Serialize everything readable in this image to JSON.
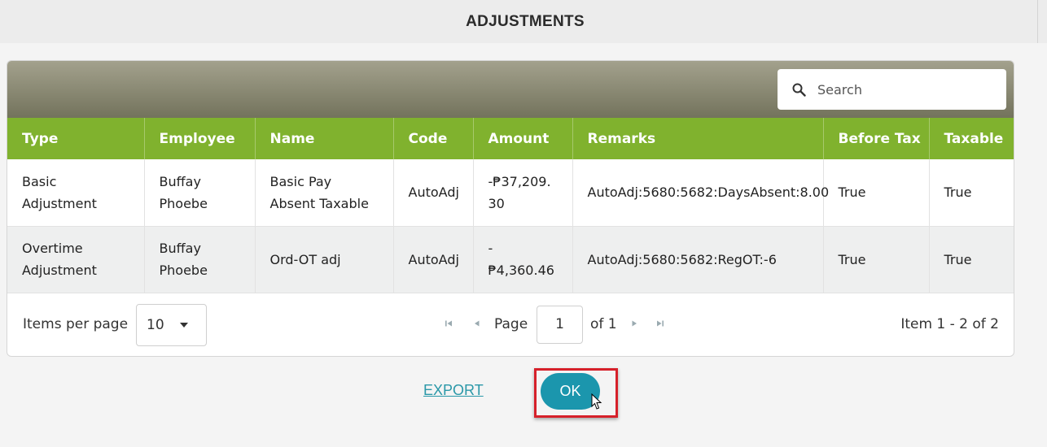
{
  "header": {
    "title": "ADJUSTMENTS"
  },
  "search": {
    "placeholder": "Search"
  },
  "columns": [
    "Type",
    "Employee",
    "Name",
    "Code",
    "Amount",
    "Remarks",
    "Before Tax",
    "Taxable"
  ],
  "rows": [
    [
      "Basic Adjustment",
      "Buffay Phoebe",
      "Basic Pay Absent Taxable",
      "AutoAdj",
      "-₱37,209.30",
      "AutoAdj:5680:5682:DaysAbsent:8.00",
      "True",
      "True"
    ],
    [
      "Overtime Adjustment",
      "Buffay Phoebe",
      "Ord-OT adj",
      "AutoAdj",
      "-₱4,360.46",
      "AutoAdj:5680:5682:RegOT:-6",
      "True",
      "True"
    ]
  ],
  "pager": {
    "items_per_page_label": "Items per page",
    "items_per_page_value": "10",
    "page_label": "Page",
    "page_value": "1",
    "of_label": "of 1",
    "item_info": "Item 1 - 2 of 2"
  },
  "actions": {
    "export_label": "EXPORT",
    "ok_label": "OK"
  },
  "colors": {
    "header_green": "#80b22e",
    "ok_teal": "#1b96ad",
    "highlight_red": "#d6202a"
  },
  "icons": [
    "search-icon",
    "chevron-down-icon",
    "first-page-icon",
    "prev-page-icon",
    "next-page-icon",
    "last-page-icon",
    "mouse-cursor-icon"
  ]
}
